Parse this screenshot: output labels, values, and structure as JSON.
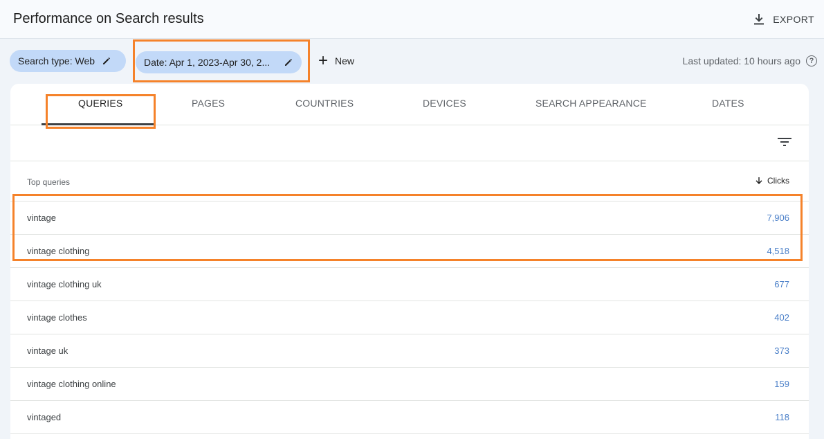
{
  "header": {
    "title": "Performance on Search results",
    "export_label": "EXPORT"
  },
  "filters": {
    "search_type": "Search type: Web",
    "date": "Date: Apr 1, 2023-Apr 30, 2...",
    "new_label": "New",
    "last_updated": "Last updated: 10 hours ago"
  },
  "tabs": [
    {
      "label": "QUERIES",
      "active": true
    },
    {
      "label": "PAGES"
    },
    {
      "label": "COUNTRIES"
    },
    {
      "label": "DEVICES"
    },
    {
      "label": "SEARCH APPEARANCE"
    },
    {
      "label": "DATES"
    }
  ],
  "table": {
    "column_query": "Top queries",
    "column_clicks": "Clicks",
    "rows": [
      {
        "query": "vintage",
        "clicks": "7,906"
      },
      {
        "query": "vintage clothing",
        "clicks": "4,518"
      },
      {
        "query": "vintage clothing uk",
        "clicks": "677"
      },
      {
        "query": "vintage clothes",
        "clicks": "402"
      },
      {
        "query": "vintage uk",
        "clicks": "373"
      },
      {
        "query": "vintage clothing online",
        "clicks": "159"
      },
      {
        "query": "vintaged",
        "clicks": "118"
      }
    ]
  },
  "colors": {
    "highlight": "#f5822a",
    "chip": "#c2d9f8",
    "clicks_value": "#4a7fc8"
  },
  "icons": {
    "export": "download-icon",
    "edit": "pencil-icon",
    "new": "plus-icon",
    "help": "help-circle-icon",
    "filter": "filter-lines-icon",
    "sort": "arrow-down-icon"
  }
}
